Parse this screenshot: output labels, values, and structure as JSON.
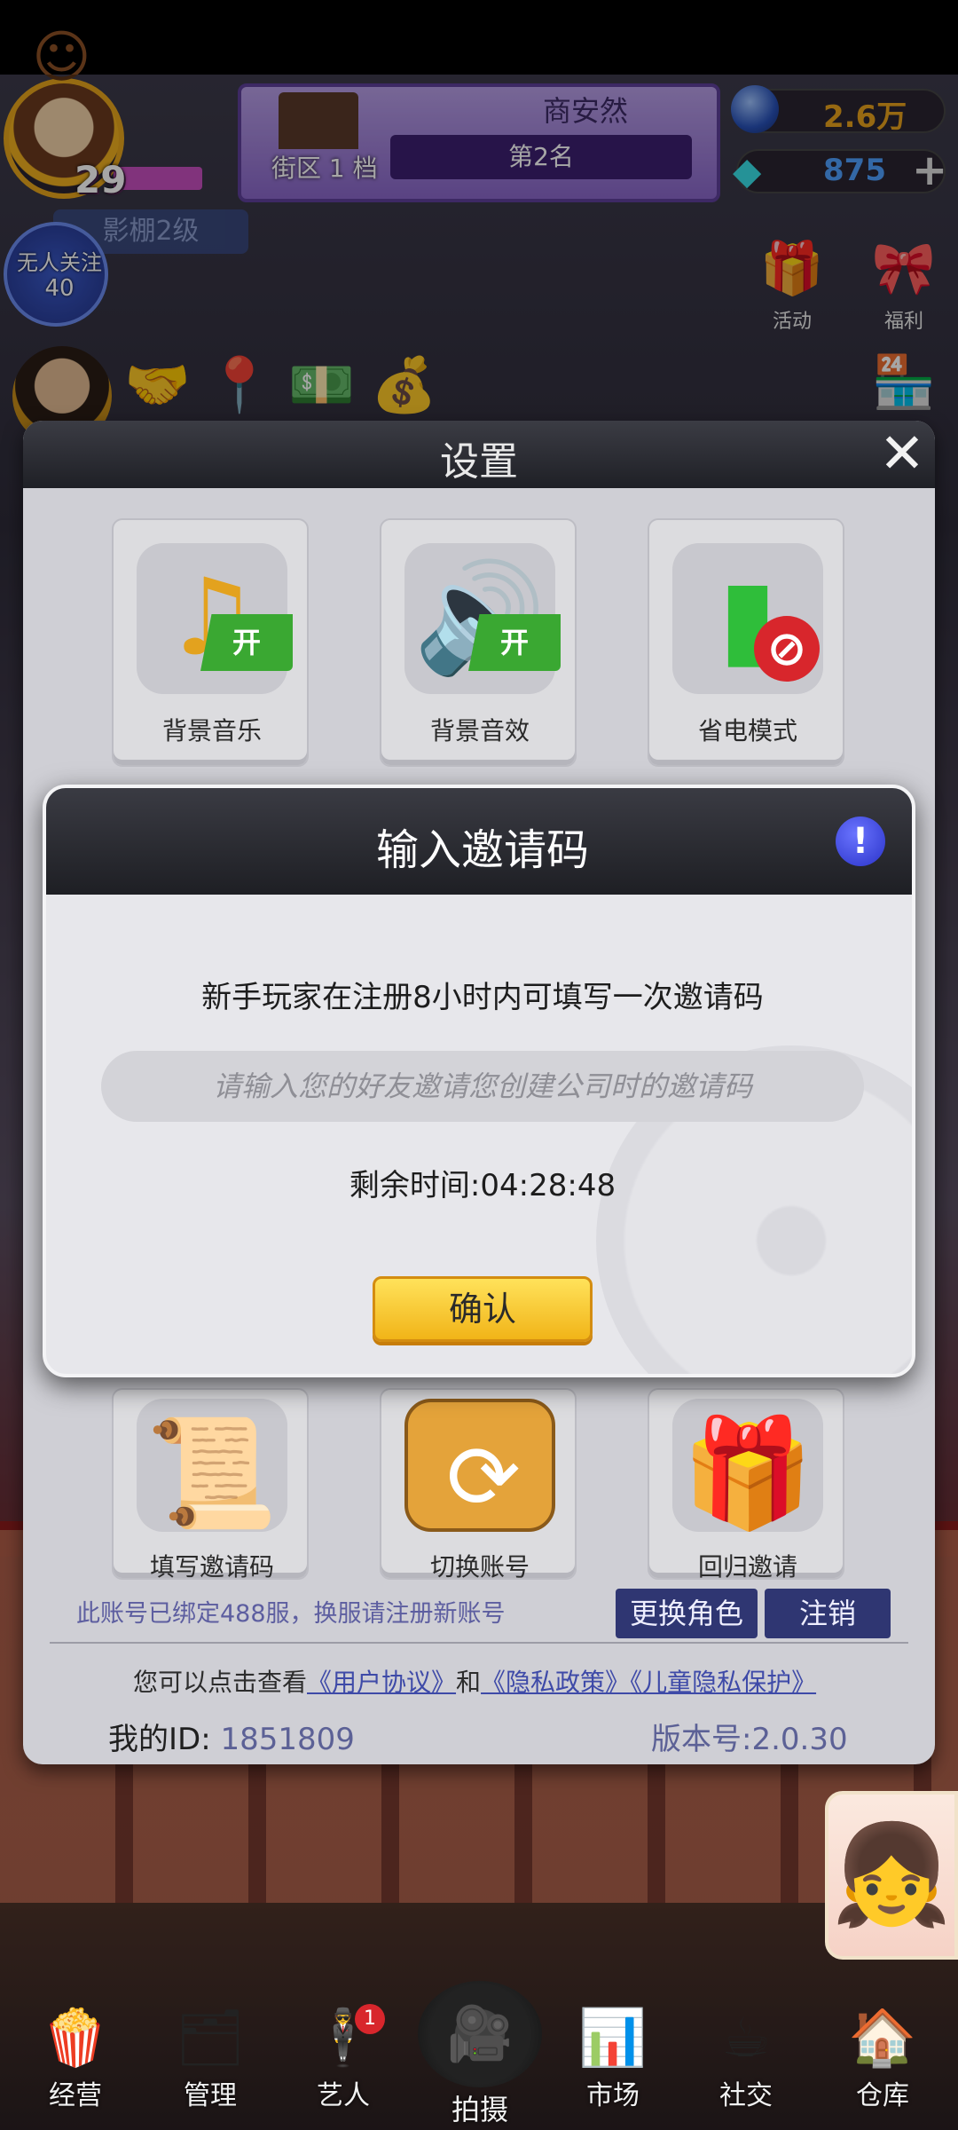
{
  "hud": {
    "player_level": "29",
    "player_name": "商安然",
    "district": "街区 1 档",
    "rank": "第2名",
    "coins": "2.6万",
    "gems": "875",
    "studio_level": "影棚2级",
    "follow_text": "无人关注",
    "follow_count": "40",
    "activity_label": "活动",
    "welfare_label": "福利",
    "shop_label": "商店"
  },
  "settings": {
    "title": "设置",
    "tiles": [
      {
        "label": "背景音乐",
        "state": "开",
        "icon": "music-note-icon"
      },
      {
        "label": "背景音效",
        "state": "开",
        "icon": "speaker-icon"
      },
      {
        "label": "省电模式",
        "icon": "battery-icon"
      },
      {
        "label": "填写邀请码",
        "icon": "scroll-quill-icon"
      },
      {
        "label": "切换账号",
        "icon": "switch-arrows-icon"
      },
      {
        "label": "回归邀请",
        "icon": "gift-calendar-icon"
      }
    ],
    "bind_note": "此账号已绑定488服，换服请注册新账号",
    "change_role_label": "更换角色",
    "logout_label": "注销",
    "agree_prefix": "您可以点击查看",
    "user_agreement": "《用户协议》",
    "and": "和",
    "privacy_policy": "《隐私政策》",
    "child_privacy": "《儿童隐私保护》",
    "my_id_label": "我的ID:",
    "my_id_value": "1851809",
    "version": "版本号:2.0.30"
  },
  "invite_dialog": {
    "title": "输入邀请码",
    "description": "新手玩家在注册8小时内可填写一次邀请码",
    "input_placeholder": "请输入您的好友邀请您创建公司时的邀请码",
    "remaining": "剩余时间:04:28:48",
    "confirm_label": "确认"
  },
  "bottom_nav": [
    {
      "label": "经营",
      "icon": "popcorn-icon"
    },
    {
      "label": "管理",
      "icon": "manage-icon"
    },
    {
      "label": "艺人",
      "icon": "artist-icon",
      "badge": "1"
    },
    {
      "label": "拍摄",
      "icon": "camera-icon"
    },
    {
      "label": "市场",
      "icon": "market-icon"
    },
    {
      "label": "社交",
      "icon": "coffee-icon"
    },
    {
      "label": "仓库",
      "icon": "warehouse-icon"
    }
  ],
  "colors": {
    "accent_yellow": "#f1b418",
    "on_badge_green": "#3aa832",
    "link_blue": "#3e4aa8",
    "panel_gray": "#cfcfd5"
  }
}
